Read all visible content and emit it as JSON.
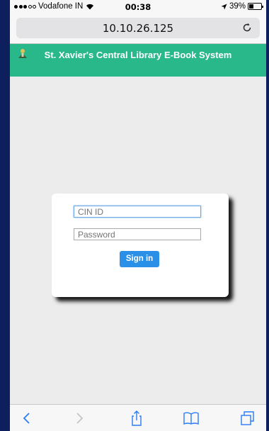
{
  "status_bar": {
    "carrier": "Vodafone IN",
    "time": "00:38",
    "battery": "39%",
    "battery_level": 0.39
  },
  "browser": {
    "url": "10.10.26.125"
  },
  "header": {
    "title": "St. Xavier's Central Library E-Book System"
  },
  "login": {
    "cin_placeholder": "CIN ID",
    "password_placeholder": "Password",
    "signin_label": "Sign in"
  },
  "colors": {
    "header_bg": "#28b88a",
    "button_bg": "#2a8fe6",
    "ios_blue": "#2a7cf6",
    "frame": "#0d1f5c"
  },
  "toolbar": {
    "icons": [
      "back-icon",
      "forward-icon",
      "share-icon",
      "bookmarks-icon",
      "tabs-icon"
    ]
  }
}
